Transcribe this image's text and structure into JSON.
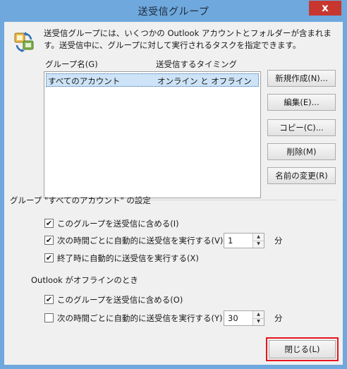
{
  "window": {
    "title": "送受信グループ",
    "close_glyph": "x"
  },
  "description": "送受信グループには、いくつかの Outlook アカウントとフォルダーが含まれます。送受信中に、グループに対して実行されるタスクを指定できます。",
  "list": {
    "col_group": "グループ名(G)",
    "col_timing": "送受信するタイミング",
    "rows": [
      {
        "name": "すべてのアカウント",
        "timing": "オンライン と オフライン",
        "selected": true
      }
    ]
  },
  "buttons": {
    "new": "新規作成(N)...",
    "edit": "編集(E)...",
    "copy": "コピー(C)...",
    "delete": "削除(M)",
    "rename": "名前の変更(R)",
    "close": "閉じる(L)"
  },
  "online": {
    "heading": "グループ \"すべてのアカウント\" の設定",
    "include_label": "このグループを送受信に含める(I)",
    "include_checked": true,
    "auto_label": "次の時間ごとに自動的に送受信を実行する(V)",
    "auto_checked": true,
    "auto_value": "1",
    "auto_unit": "分",
    "exit_label": "終了時に自動的に送受信を実行する(X)",
    "exit_checked": true
  },
  "offline": {
    "heading": "Outlook がオフラインのとき",
    "include_label": "このグループを送受信に含める(O)",
    "include_checked": true,
    "auto_label": "次の時間ごとに自動的に送受信を実行する(Y)",
    "auto_checked": false,
    "auto_value": "30",
    "auto_unit": "分"
  },
  "icons": {
    "app": "send-receive-groups-icon",
    "spin_up": "▲",
    "spin_down": "▼",
    "check": "✔"
  },
  "colors": {
    "titlebar": "#6ea8dd",
    "close_button": "#c7372f",
    "selection": "#cde3f7",
    "highlight_border": "#e8141e"
  }
}
